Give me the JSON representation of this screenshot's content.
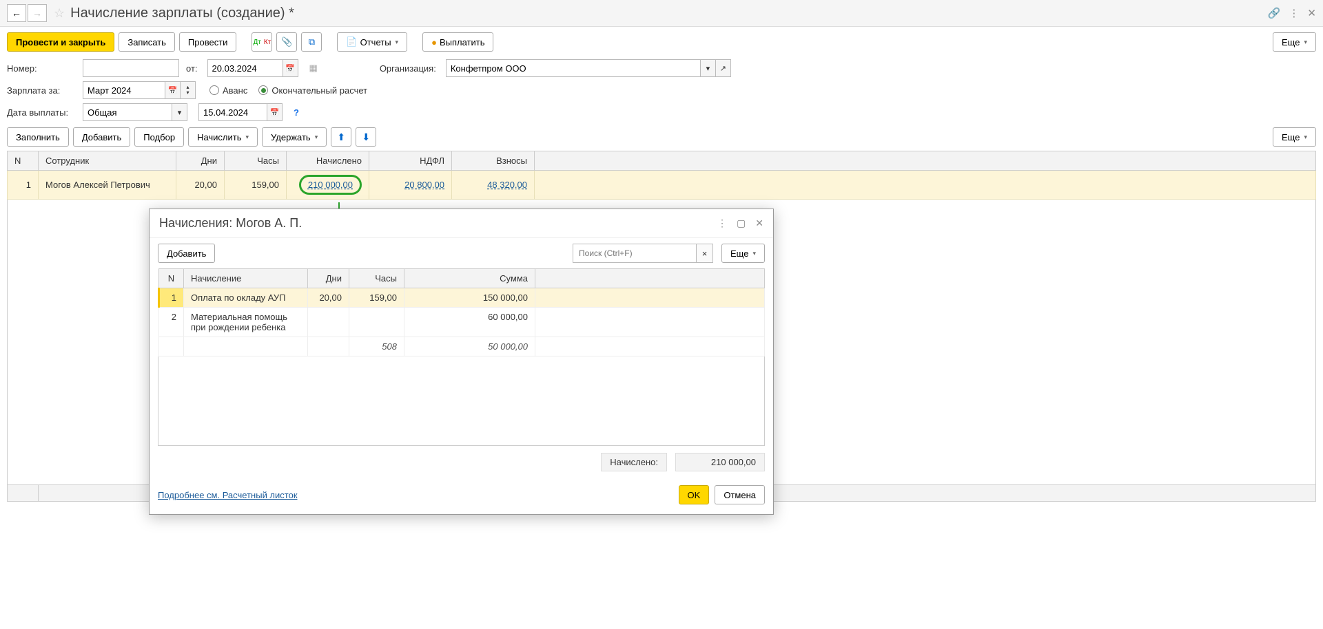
{
  "header": {
    "title": "Начисление зарплаты (создание) *"
  },
  "toolbar": {
    "post_close": "Провести и закрыть",
    "save": "Записать",
    "post": "Провести",
    "reports": "Отчеты",
    "pay": "Выплатить",
    "more": "Еще"
  },
  "form": {
    "number_label": "Номер:",
    "number_value": "",
    "from_label": "от:",
    "from_value": "20.03.2024",
    "org_label": "Организация:",
    "org_value": "Конфетпром ООО",
    "salary_for_label": "Зарплата за:",
    "salary_for_value": "Март 2024",
    "advance_label": "Аванс",
    "final_label": "Окончательный расчет",
    "pay_date_label": "Дата выплаты:",
    "pay_date_mode": "Общая",
    "pay_date_value": "15.04.2024"
  },
  "toolbar2": {
    "fill": "Заполнить",
    "add": "Добавить",
    "pick": "Подбор",
    "accrue": "Начислить",
    "withhold": "Удержать",
    "more": "Еще"
  },
  "main_cols": {
    "n": "N",
    "employee": "Сотрудник",
    "days": "Дни",
    "hours": "Часы",
    "accrued": "Начислено",
    "ndfl": "НДФЛ",
    "contrib": "Взносы"
  },
  "main_rows": [
    {
      "n": "1",
      "employee": "Могов Алексей Петрович",
      "days": "20,00",
      "hours": "159,00",
      "accrued": "210 000,00",
      "ndfl": "20 800,00",
      "contrib": "48 320,00"
    }
  ],
  "modal": {
    "title": "Начисления: Могов А. П.",
    "add": "Добавить",
    "search_placeholder": "Поиск (Ctrl+F)",
    "more": "Еще",
    "cols": {
      "n": "N",
      "name": "Начисление",
      "days": "Дни",
      "hours": "Часы",
      "sum": "Сумма"
    },
    "rows": [
      {
        "n": "1",
        "name": "Оплата по окладу АУП",
        "days": "20,00",
        "hours": "159,00",
        "sum": "150 000,00"
      },
      {
        "n": "2",
        "name": "Материальная помощь при рождении ребенка",
        "days": "",
        "hours": "",
        "sum": "60 000,00"
      }
    ],
    "sub": {
      "code": "508",
      "sum": "50 000,00"
    },
    "total_label": "Начислено:",
    "total_value": "210 000,00",
    "link": "Подробнее см. Расчетный листок",
    "ok": "OK",
    "cancel": "Отмена"
  }
}
